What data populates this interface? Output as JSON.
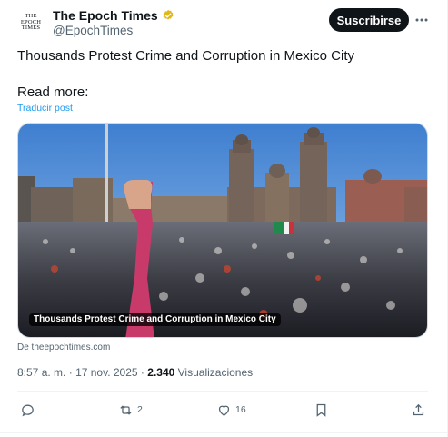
{
  "account": {
    "avatar_text": [
      "THE",
      "EPOCH",
      "TIMES"
    ],
    "display_name": "The Epoch Times",
    "handle": "@EpochTimes",
    "verified_badge_color": "#e2b719"
  },
  "header": {
    "subscribe_label": "Suscribirse",
    "more_icon": "more-horizontal-icon"
  },
  "post": {
    "text": "Thousands Protest Crime and Corruption in Mexico City",
    "read_more": "Read more:",
    "translate_label": "Traducir post"
  },
  "card": {
    "caption": "Thousands Protest Crime and Corruption in Mexico City",
    "source": "De theepochtimes.com"
  },
  "meta": {
    "time": "8:57 a. m.",
    "separator": "·",
    "date": "17 nov. 2025",
    "separator2": "·",
    "views_count": "2.340",
    "views_label": "Visualizaciones"
  },
  "actions": {
    "reply_count": "",
    "repost_count": "2",
    "like_count": "16"
  },
  "colors": {
    "accent": "#1d9bf0",
    "text_primary": "#0f1419",
    "text_secondary": "#536471",
    "button_dark": "#0f1419"
  }
}
